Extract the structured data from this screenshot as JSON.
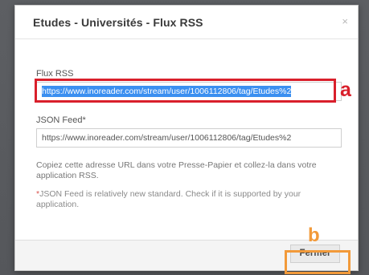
{
  "dialog": {
    "title": "Etudes - Universités - Flux RSS",
    "close_label": "×"
  },
  "rss": {
    "label": "Flux RSS",
    "value": "https://www.inoreader.com/stream/user/1006112806/tag/Etudes%2"
  },
  "json_feed": {
    "label": "JSON Feed*",
    "value": "https://www.inoreader.com/stream/user/1006112806/tag/Etudes%2"
  },
  "help": {
    "copy_text": "Copiez cette adresse URL dans votre Presse-Papier et collez-la dans votre application RSS.",
    "json_star": "*",
    "json_note": "JSON Feed is relatively new standard. Check if it is supported by your application."
  },
  "footer": {
    "close_button": "Fermer"
  },
  "annotations": {
    "a": "a",
    "b": "b",
    "colors": {
      "a": "#d91f2b",
      "b": "#f29a3a"
    }
  },
  "colors": {
    "selection": "#3b8ff0",
    "backdrop": "#585a5e"
  }
}
